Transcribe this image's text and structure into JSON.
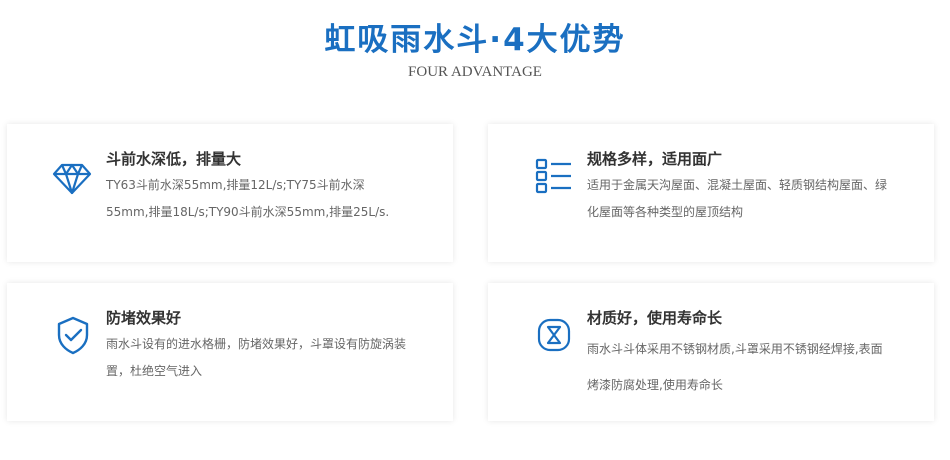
{
  "header": {
    "title": "虹吸雨水斗·4大优势",
    "subtitle": "FOUR ADVANTAGE"
  },
  "cards": [
    {
      "title": "斗前水深低，排量大",
      "desc": "TY63斗前水深55mm,排量12L/s;TY75斗前水深55mm,排量18L/s;TY90斗前水深55mm,排量25L/s.",
      "icon": "diamond-icon"
    },
    {
      "title": "规格多样，适用面广",
      "desc": "适用于金属天沟屋面、混凝土屋面、轻质钢结构屋面、绿化屋面等各种类型的屋顶结构",
      "icon": "list-icon"
    },
    {
      "title": "防堵效果好",
      "desc": "雨水斗设有的进水格栅，防堵效果好，斗罩设有防旋涡装置，杜绝空气进入",
      "icon": "shield-check-icon"
    },
    {
      "title": "材质好，使用寿命长",
      "desc": "雨水斗斗体采用不锈钢材质,斗罩采用不锈钢经焊接,表面烤漆防腐处理,使用寿命长",
      "icon": "hourglass-icon"
    }
  ],
  "colors": {
    "accent": "#1a6fc1",
    "title_text": "#333333",
    "body_text": "#666666"
  }
}
